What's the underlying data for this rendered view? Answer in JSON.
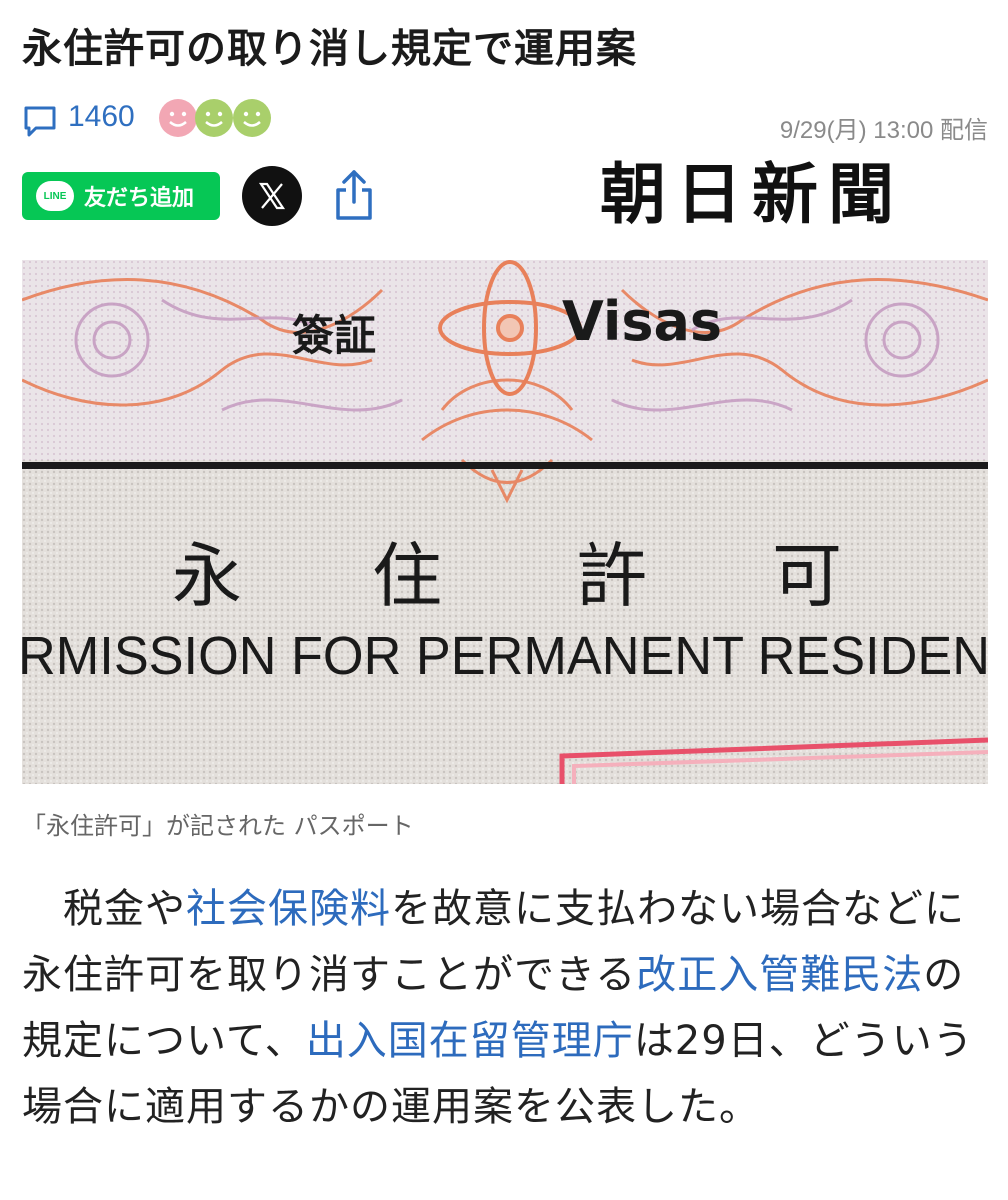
{
  "article": {
    "title": "永住許可の取り消し規定で運用案",
    "comment_count": "1460",
    "published": "9/29(月) 13:00 配信",
    "publisher_logo_text": "朝日新聞",
    "caption": "「永住許可」が記された パスポート"
  },
  "share": {
    "line_logo_text": "LINE",
    "line_label": "友だち追加",
    "x_label": "X"
  },
  "photo_text": {
    "visas_cn": "簽証",
    "visas_en": "Visas",
    "kanji": [
      "永",
      "住",
      "許",
      "可"
    ],
    "permission": "RMISSION FOR PERMANENT RESIDEN"
  },
  "body": {
    "p1": "　税金や",
    "link1": "社会保険料",
    "p2": "を故意に支払わない場合などに永住許可を取り消すことができる",
    "link2": "改正入管難民法",
    "p3": "の規定について、",
    "link3": "出入国在留管理庁",
    "p4": "は29日、どういう場合に適用するかの運用案を公表した。"
  },
  "colors": {
    "accent_blue": "#2d6bbd",
    "line_green": "#06c755",
    "face_pink": "#f2a7b4",
    "face_green": "#a9cf6b"
  },
  "icons": [
    "comment-icon",
    "smile-face-icon",
    "line-logo-icon",
    "x-logo-icon",
    "share-icon"
  ]
}
